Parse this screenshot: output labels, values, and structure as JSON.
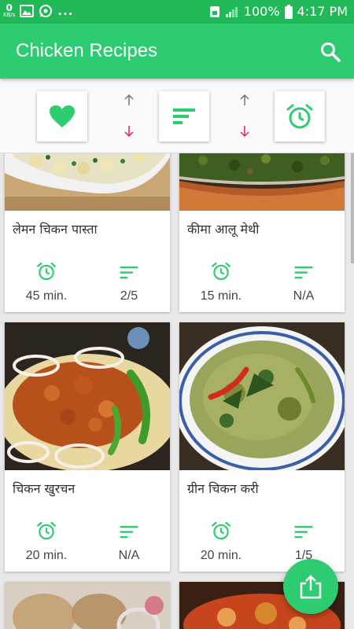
{
  "status_bar": {
    "kbs_value": "0",
    "kbs_unit": "KB/s",
    "dots": "...",
    "battery": "100%",
    "time": "4:17 PM"
  },
  "app_bar": {
    "title": "Chicken Recipes"
  },
  "colors": {
    "primary": "#2ecc71",
    "status": "#21b957",
    "arrow_up": "#757575",
    "arrow_down": "#e91e63"
  },
  "sort_bar": {
    "items": [
      {
        "icon": "heart-icon"
      },
      {
        "icon": "sort-lines-icon"
      },
      {
        "icon": "alarm-clock-icon"
      }
    ]
  },
  "recipes": [
    {
      "name": "लेमन चिकन पास्ता",
      "time": "45 min.",
      "difficulty": "2/5"
    },
    {
      "name": "कीमा आलू मेथी",
      "time": "15 min.",
      "difficulty": "N/A"
    },
    {
      "name": "चिकन खुरचन",
      "time": "20 min.",
      "difficulty": "N/A"
    },
    {
      "name": "ग्रीन चिकन करी",
      "time": "20 min.",
      "difficulty": "1/5"
    }
  ]
}
